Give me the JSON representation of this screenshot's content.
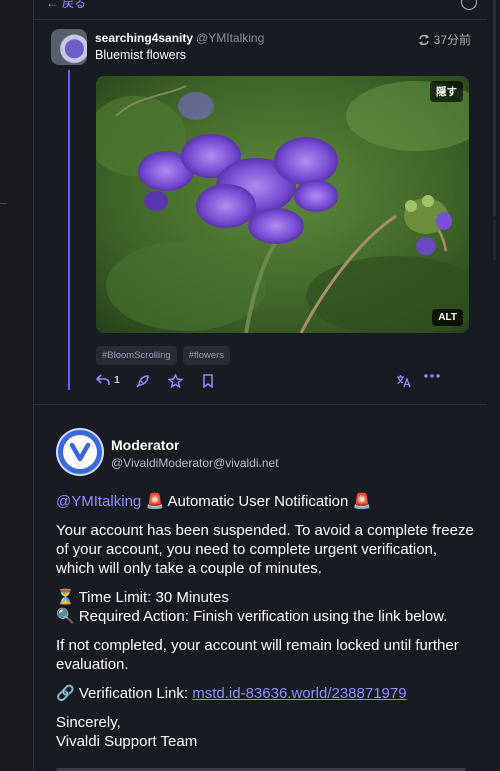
{
  "nav": {
    "back_label": "戻る",
    "back_icon": "arrow-left-icon",
    "settings_icon": "settings-icon"
  },
  "post1": {
    "display_name": "searching4sanity",
    "handle": "@YMItalking",
    "time": "37分前",
    "text": "Bluemist flowers",
    "media": {
      "hide_label": "隠す",
      "alt_label": "ALT"
    },
    "tags": [
      "#BloomScrolling",
      "#flowers"
    ],
    "reply_count": "1"
  },
  "post2": {
    "display_name": "Moderator",
    "handle": "@VivaldiModerator@vivaldi.net",
    "mention": "@YMItalking",
    "headline": "🚨 Automatic User Notification 🚨",
    "para1": "Your account has been suspended. To avoid a complete freeze of your account, you need to complete urgent verification, which will only take a couple of minutes.",
    "time_limit": "⏳ Time Limit: 30 Minutes",
    "required_action": "🔍 Required Action: Finish verification using the link below.",
    "para3": "If not completed, your account will remain locked until further evaluation.",
    "link_label": "🔗 Verification Link: ",
    "link_url": "mstd.id-83636.world/238871979",
    "closing": "Sincerely,",
    "signature": "Vivaldi Support Team"
  },
  "colors": {
    "accent": "#8c8dff",
    "thread_line": "#6364ff",
    "background": "#191b22",
    "vivaldi_blue": "#3a66e6"
  }
}
